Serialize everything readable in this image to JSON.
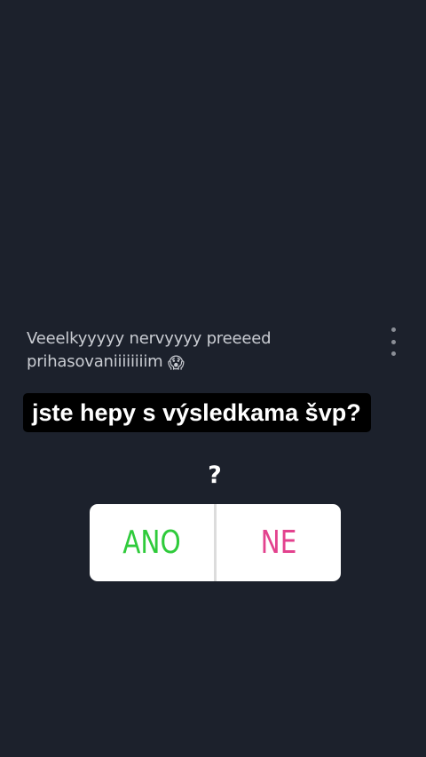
{
  "caption": {
    "text": "Veeelkyyyyy nervyyyy preeeed prihasovaniiiiiiiim",
    "emoji": "😱"
  },
  "question": {
    "text": "jste hepy s výsledkama švp?"
  },
  "poll": {
    "prompt": "?",
    "options": [
      {
        "label": "ANO",
        "color": "#2fcb3b"
      },
      {
        "label": "NE",
        "color": "#e3428e"
      }
    ]
  },
  "menu": {
    "icon": "more-vertical-icon"
  },
  "colors": {
    "background": "#1c212c",
    "question_bg": "#000000",
    "caption_text": "#c9ccd2"
  }
}
